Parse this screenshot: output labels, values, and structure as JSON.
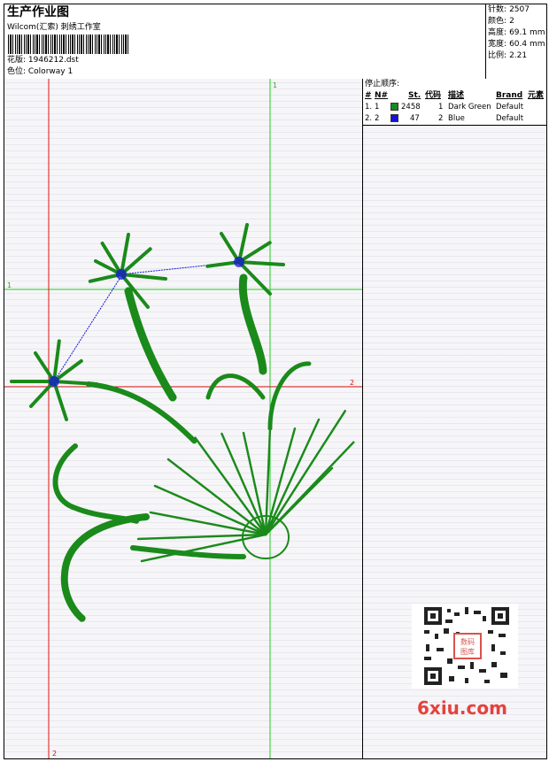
{
  "header": {
    "title": "生产作业图",
    "org": "Wilcom(汇索) 刺绣工作室",
    "design": "花版: 1946212.dst",
    "colorway": "色位: Colorway 1"
  },
  "stats": [
    {
      "key": "针数",
      "value": "2507"
    },
    {
      "key": "颜色",
      "value": "2"
    },
    {
      "key": "高度",
      "value": "69.1 mm"
    },
    {
      "key": "宽度",
      "value": "60.4 mm"
    },
    {
      "key": "比例",
      "value": "2.21"
    }
  ],
  "stop_sequence": {
    "title": "停止顺序:",
    "columns": [
      "#",
      "N#",
      "St.",
      "代码",
      "描述",
      "Brand",
      "元素"
    ],
    "rows": [
      {
        "idx": "1.",
        "n": "1",
        "color": "#1a8a1a",
        "stitches": "2458",
        "code": "1",
        "desc": "Dark Green",
        "brand": "Default"
      },
      {
        "idx": "2.",
        "n": "2",
        "color": "#1515d8",
        "stitches": "47",
        "code": "2",
        "desc": "Blue",
        "brand": "Default"
      }
    ]
  },
  "guides": {
    "v1": "1",
    "h1": "1",
    "h2": "2",
    "v2": "2"
  },
  "watermark": {
    "site": "6xiu.com",
    "seal": "数码 图库"
  },
  "colors": {
    "stitch_green": "#1a8a1a",
    "stitch_blue": "#1515d8",
    "guide_green": "#22cc22",
    "guide_red": "#dd1111"
  }
}
